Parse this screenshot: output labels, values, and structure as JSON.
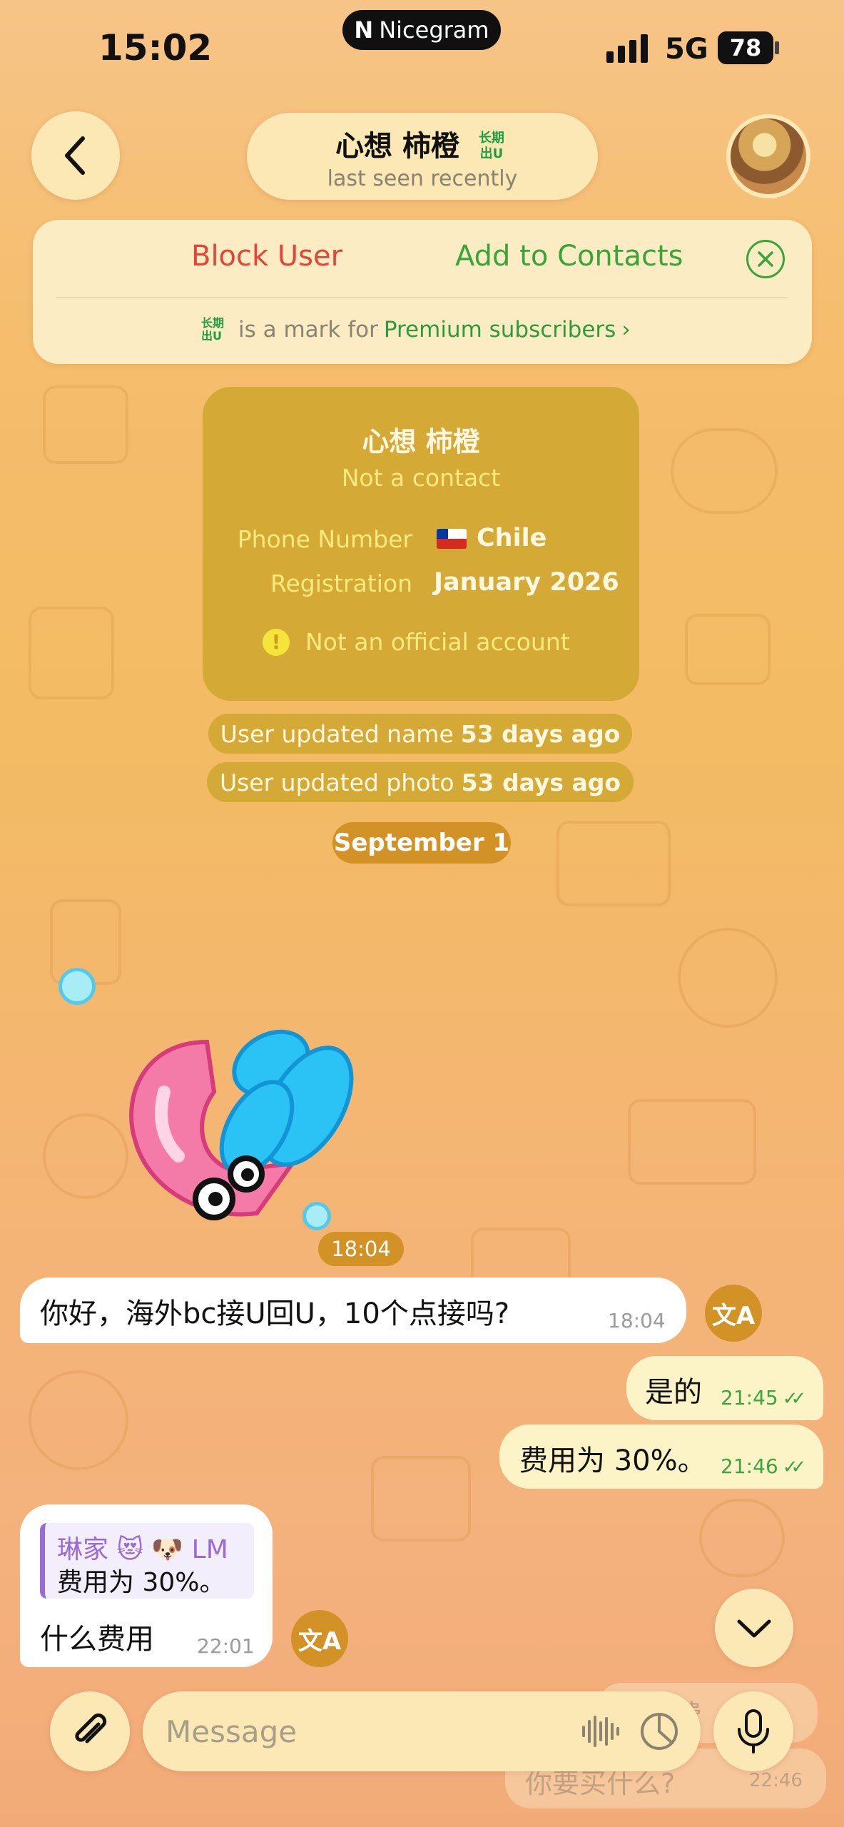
{
  "status_bar": {
    "time": "15:02",
    "carrier_app": "Nicegram",
    "network": "5G",
    "battery": "78"
  },
  "header": {
    "back_icon": "chevron-left-icon",
    "name": "心想 柿橙",
    "premium_badge": "长期出U",
    "subtitle": "last seen recently"
  },
  "action_banner": {
    "block_label": "Block User",
    "add_label": "Add to Contacts",
    "premium_badge": "长期出U",
    "premium_text": "is a mark for",
    "premium_link": "Premium subscribers",
    "premium_chevron": "›"
  },
  "info_card": {
    "name": "心想 柿橙",
    "status": "Not a contact",
    "phone_label": "Phone Number",
    "phone_value": "Chile",
    "reg_label": "Registration",
    "reg_value": "January 2026",
    "warning": "Not an official account"
  },
  "service": [
    {
      "text": "User updated name",
      "bold": "53 days ago"
    },
    {
      "text": "User updated photo",
      "bold": "53 days ago"
    }
  ],
  "date_separator": "September 1",
  "sticker": {
    "time": "18:04"
  },
  "messages": [
    {
      "dir": "in",
      "text": "你好，海外bc接U回U，10个点接吗?",
      "time": "18:04"
    },
    {
      "dir": "out",
      "text": "是的",
      "time": "21:45"
    },
    {
      "dir": "out",
      "text": "费用为 30%。",
      "time": "21:46"
    },
    {
      "dir": "in",
      "reply_name": "琳家 😻 🐶 LM",
      "reply_text": "费用为 30%。",
      "text": "什么费用",
      "time": "22:01"
    }
  ],
  "faded": {
    "a": "费",
    "b": "你要买什么?",
    "b_time": "22:46"
  },
  "translate_icon": "文A",
  "composer": {
    "placeholder": "Message"
  },
  "colors": {
    "accent_green": "#38a538",
    "danger": "#e2453a",
    "service_bg": "#d5a936",
    "date_bg": "#d39226"
  }
}
